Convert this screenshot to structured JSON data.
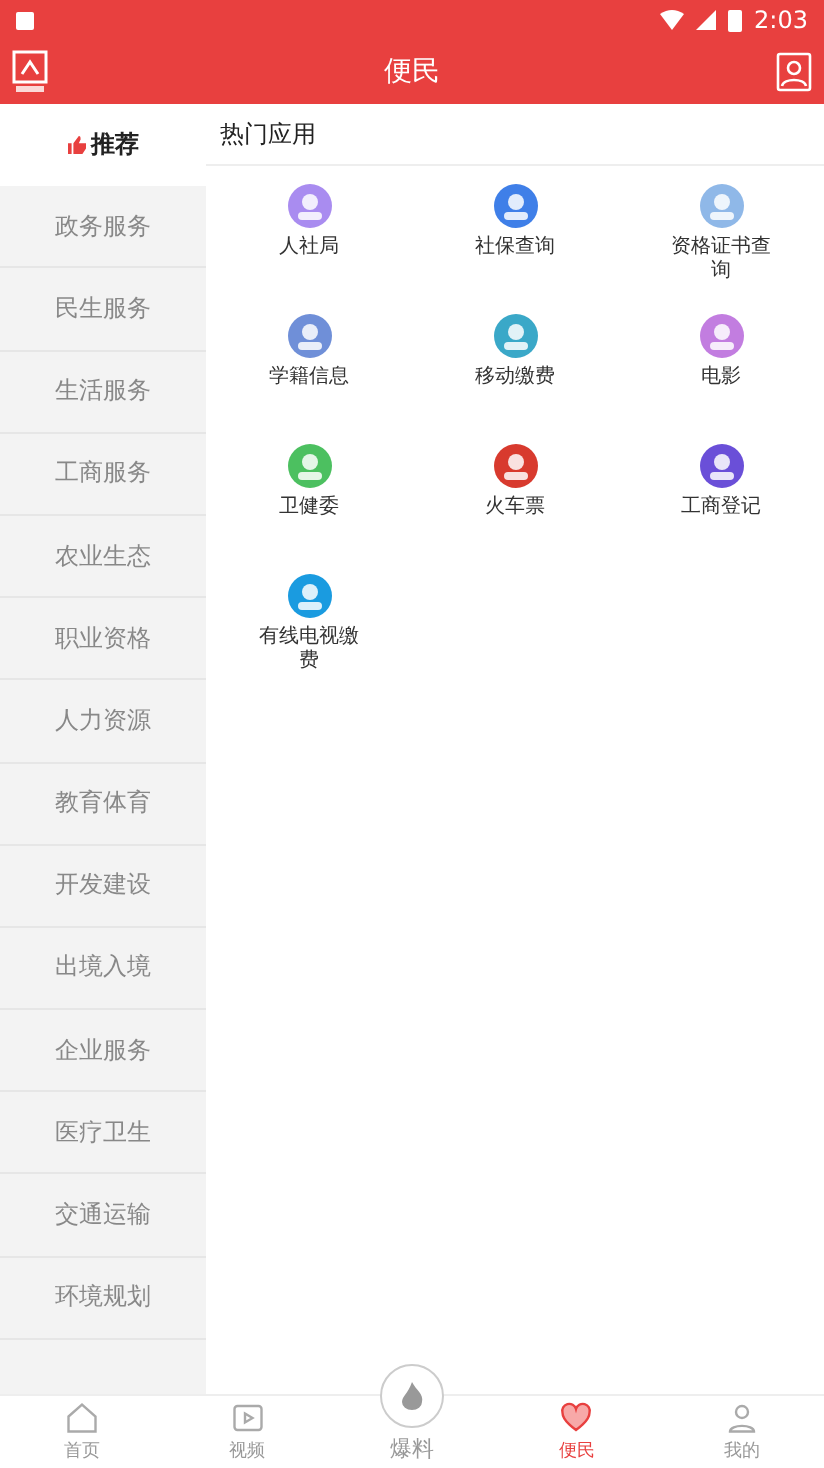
{
  "status_bar": {
    "time": "2:03"
  },
  "header": {
    "title": "便民"
  },
  "sidebar": {
    "items": [
      {
        "label": "推荐",
        "selected": true
      },
      {
        "label": "政务服务",
        "selected": false
      },
      {
        "label": "民生服务",
        "selected": false
      },
      {
        "label": "生活服务",
        "selected": false
      },
      {
        "label": "工商服务",
        "selected": false
      },
      {
        "label": "农业生态",
        "selected": false
      },
      {
        "label": "职业资格",
        "selected": false
      },
      {
        "label": "人力资源",
        "selected": false
      },
      {
        "label": "教育体育",
        "selected": false
      },
      {
        "label": "开发建设",
        "selected": false
      },
      {
        "label": "出境入境",
        "selected": false
      },
      {
        "label": "企业服务",
        "selected": false
      },
      {
        "label": "医疗卫生",
        "selected": false
      },
      {
        "label": "交通运输",
        "selected": false
      },
      {
        "label": "环境规划",
        "selected": false
      }
    ]
  },
  "section": {
    "title": "热门应用"
  },
  "apps": [
    {
      "label": "人社局",
      "color": "#a98cf0"
    },
    {
      "label": "社保查询",
      "color": "#3f7fe8"
    },
    {
      "label": "资格证书查询",
      "color": "#8fb8e8"
    },
    {
      "label": "学籍信息",
      "color": "#6f8fd8"
    },
    {
      "label": "移动缴费",
      "color": "#3aa8c8"
    },
    {
      "label": "电影",
      "color": "#c27de0"
    },
    {
      "label": "卫健委",
      "color": "#4cc060"
    },
    {
      "label": "火车票",
      "color": "#d83a2e"
    },
    {
      "label": "工商登记",
      "color": "#6a4fd8"
    },
    {
      "label": "有线电视缴费",
      "color": "#1a9be0"
    }
  ],
  "bottom_nav": [
    {
      "label": "首页",
      "kind": "home",
      "selected": false
    },
    {
      "label": "视频",
      "kind": "video",
      "selected": false
    },
    {
      "label": "爆料",
      "kind": "hot",
      "selected": false
    },
    {
      "label": "便民",
      "kind": "heart",
      "selected": true
    },
    {
      "label": "我的",
      "kind": "user",
      "selected": false
    }
  ]
}
